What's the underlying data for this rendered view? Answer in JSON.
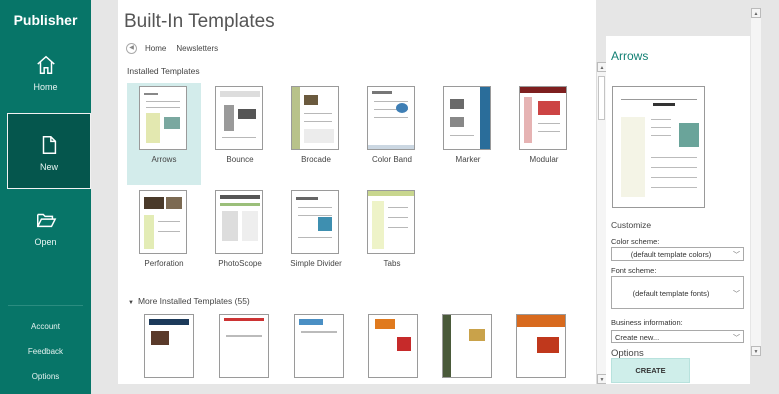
{
  "sidebar": {
    "app_title": "Publisher",
    "home_label": "Home",
    "new_label": "New",
    "open_label": "Open",
    "account_label": "Account",
    "feedback_label": "Feedback",
    "options_label": "Options",
    "icons": {
      "home": "home-icon",
      "new": "new-document-icon",
      "open": "folder-open-icon"
    }
  },
  "main": {
    "title": "Built-In Templates",
    "breadcrumb": {
      "home": "Home",
      "current": "Newsletters"
    },
    "installed_heading": "Installed Templates",
    "templates": [
      {
        "label": "Arrows",
        "selected": true
      },
      {
        "label": "Bounce"
      },
      {
        "label": "Brocade"
      },
      {
        "label": "Color Band"
      },
      {
        "label": "Marker"
      },
      {
        "label": "Modular"
      },
      {
        "label": "Perforation"
      },
      {
        "label": "PhotoScope"
      },
      {
        "label": "Simple Divider"
      },
      {
        "label": "Tabs"
      }
    ],
    "more_heading": "More Installed Templates (55)"
  },
  "right_panel": {
    "title": "Arrows",
    "customize_heading": "Customize",
    "color_scheme_label": "Color scheme:",
    "color_scheme_value": "(default template colors)",
    "font_scheme_label": "Font scheme:",
    "font_scheme_value": "(default template fonts)",
    "business_info_label": "Business information:",
    "business_info_value": "Create new...",
    "options_heading": "Options",
    "create_label": "CREATE"
  },
  "colors": {
    "sidebar": "#077568",
    "sidebar_selected": "#05564d",
    "accent": "#138074",
    "selection": "#d3eceb"
  }
}
